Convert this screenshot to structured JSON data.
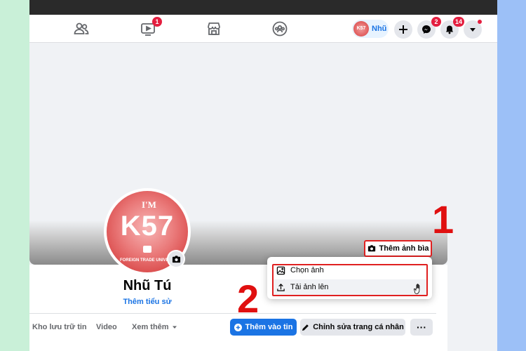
{
  "navbar": {
    "badges": {
      "watch": "1",
      "messenger": "2",
      "notifications": "14"
    },
    "profile_chip_name": "Nhũ",
    "avatar_text": "K57"
  },
  "profile": {
    "name": "Nhũ Tú",
    "bio_link": "Thêm tiểu sử",
    "avatar": {
      "top_text": "I'M",
      "main_text": "K57",
      "bottom_text": "FOREIGN TRADE UNIVERS"
    }
  },
  "cover": {
    "add_cover_label": "Thêm ảnh bìa"
  },
  "dropdown": {
    "items": [
      {
        "label": "Chọn ảnh",
        "icon": "image-icon"
      },
      {
        "label": "Tải ảnh lên",
        "icon": "upload-icon"
      }
    ]
  },
  "tabs": [
    {
      "label": "Kho lưu trữ tin"
    },
    {
      "label": "Video"
    },
    {
      "label": "Xem thêm"
    }
  ],
  "actions": {
    "add_story": "Thêm vào tin",
    "edit_profile": "Chỉnh sửa trang cá nhân",
    "more": "···"
  },
  "annotations": {
    "step1": "1",
    "step2": "2"
  },
  "colors": {
    "accent": "#1b74e4",
    "annotation_red": "#e02020",
    "badge_red": "#e41e3f",
    "left_bg": "#c9f0d8",
    "right_bg": "#9cc0f7"
  }
}
